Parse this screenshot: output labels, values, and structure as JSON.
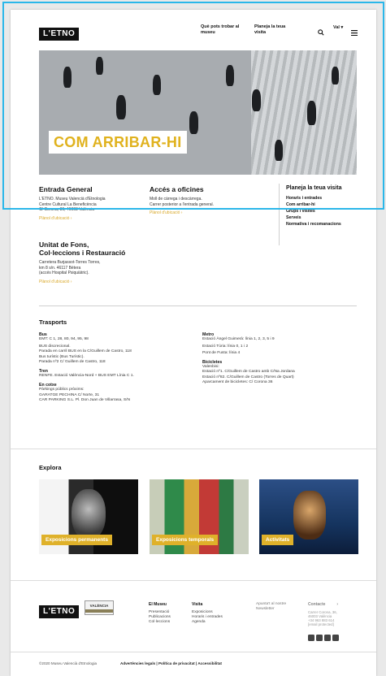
{
  "header": {
    "logo": "L'ETNO",
    "nav": [
      "Què pots trobar al museu",
      "Planeja la teua visita"
    ],
    "language": "Val",
    "search_icon": "search-icon",
    "menu_icon": "hamburger-icon"
  },
  "hero": {
    "title": "COM ARRIBAR-HI"
  },
  "entrada": {
    "title": "Entrada General",
    "lines": [
      "L'ETNO. Museu Valencià d'Etnologia",
      "Centre Cultural La Beneficència",
      "C/ Corona, 36, 46003 València"
    ],
    "link": "Plànol d'ubicació ›"
  },
  "oficines": {
    "title": "Accés a oficines",
    "lines": [
      "Moll de càrrega i descàrrega.",
      "Carrer posterior a l'entrada general."
    ],
    "link": "Plànol d'ubicació ›"
  },
  "side": {
    "title": "Planeja la teua visita",
    "items": [
      "Horaris i entrades",
      "Com arribar-hi",
      "Grups i visites",
      "Serveis",
      "Normativa i recomanacions"
    ]
  },
  "fons": {
    "title1": "Unitat de Fons,",
    "title2": "Col·leccions i Restauració",
    "lines": [
      "Carretera Burjassot-Torres Torres,",
      "km 8 s/n. 46117 Bétera",
      "(accés Hospital Psiquiàtric)."
    ],
    "link": "Plànol d'ubicació ›"
  },
  "transports": {
    "title": "Trasports",
    "left": [
      {
        "h": "Bus",
        "t": [
          "EMT: C 1, 28, 80, 94, 95, 98",
          "BUS discrecional.",
          "Parada en carril BUS en la C/Guillem de Castro, 118",
          "Bus turístic (Bus Turístic).",
          "Parada nº2 C/ Guillem de Castro, 118"
        ]
      },
      {
        "h": "Tren",
        "t": [
          "RENFE. Estació València-Nord + BUS EMT Línia C 1."
        ]
      },
      {
        "h": "En cotxe",
        "t": [
          "Pàrkings públics pròxims:",
          "GARATGE PECHINA C/ Norte, 31",
          "CAR PARKING S.L. Pl. Don Juan de Villarrasa, S/N"
        ]
      }
    ],
    "right": [
      {
        "h": "Metro",
        "t": [
          "Estació Àngel Guimerà: línia 1, 2, 3, 5 i 9",
          "Estació Túria: línia 0, 1 i 2",
          "Pont de Fusta: línia 4"
        ]
      },
      {
        "h": "Bicicletes",
        "t": [
          "Valenbisi:",
          "Estació nº1. C/Guillem de Castro amb C/Na Jordana",
          "Estació nº82. C/Guillem de Castro (Torres de Quart)",
          "Aparcament de bicicletes: C/ Corona 36"
        ]
      }
    ]
  },
  "explora": {
    "title": "Explora",
    "cards": [
      "Exposicions permanents",
      "Exposicions temporals",
      "Activitats"
    ]
  },
  "footer": {
    "logo": "L'ETNO",
    "partner": "VALÈNCIA",
    "cols": [
      {
        "h": "El Museu",
        "items": [
          "Presentació",
          "Publicacions",
          "Col·leccions"
        ]
      },
      {
        "h": "Visita",
        "items": [
          "Exposicions",
          "Horaris i entrades",
          "Agenda"
        ]
      }
    ],
    "newsletter": "Apunta't al nostre Newsletter",
    "contact_h": "Contacte",
    "contact": [
      "Carrer Corona, 36,",
      "46003 València",
      "+34 963 883 614",
      "[email protected]"
    ],
    "copyright": "©2020 Museu Valencià d'Etnologia",
    "legal": "Advertències legals | Política de privacitat | Accessibilitat"
  }
}
